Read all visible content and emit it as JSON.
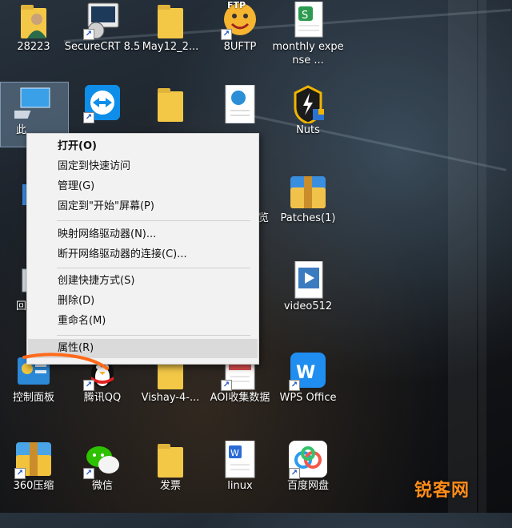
{
  "desktop": {
    "icons": [
      {
        "label": "28223"
      },
      {
        "label": "SecureCRT 8.5"
      },
      {
        "label": "May12_2..."
      },
      {
        "label": "8UFTP"
      },
      {
        "label": "monthly expense ..."
      },
      {
        "label": "此电脑"
      },
      {
        "label": "TeamViewer"
      },
      {
        "label": ""
      },
      {
        "label": ""
      },
      {
        "label": "Nuts"
      },
      {
        "label": "Patches(1)"
      },
      {
        "label": "video512"
      },
      {
        "label": "控制面板"
      },
      {
        "label": "腾讯QQ"
      },
      {
        "label": "Vishay-4-..."
      },
      {
        "label": "AOI收集数据"
      },
      {
        "label": "WPS Office"
      },
      {
        "label": "360压缩"
      },
      {
        "label": "微信"
      },
      {
        "label": "发票"
      },
      {
        "label": "linux"
      },
      {
        "label": "百度网盘"
      }
    ],
    "partial_labels": [
      "此",
      "回",
      "览"
    ],
    "ftp_badge": "FTP"
  },
  "context_menu": {
    "items": [
      {
        "label": "打开(O)"
      },
      {
        "label": "固定到快速访问"
      },
      {
        "label": "管理(G)"
      },
      {
        "label": "固定到\"开始\"屏幕(P)"
      },
      {
        "label": "映射网络驱动器(N)..."
      },
      {
        "label": "断开网络驱动器的连接(C)..."
      },
      {
        "label": "创建快捷方式(S)"
      },
      {
        "label": "删除(D)"
      },
      {
        "label": "重命名(M)"
      },
      {
        "label": "属性(R)"
      }
    ]
  },
  "annotation_color": "#ff6a1a",
  "watermark": "锐客网"
}
